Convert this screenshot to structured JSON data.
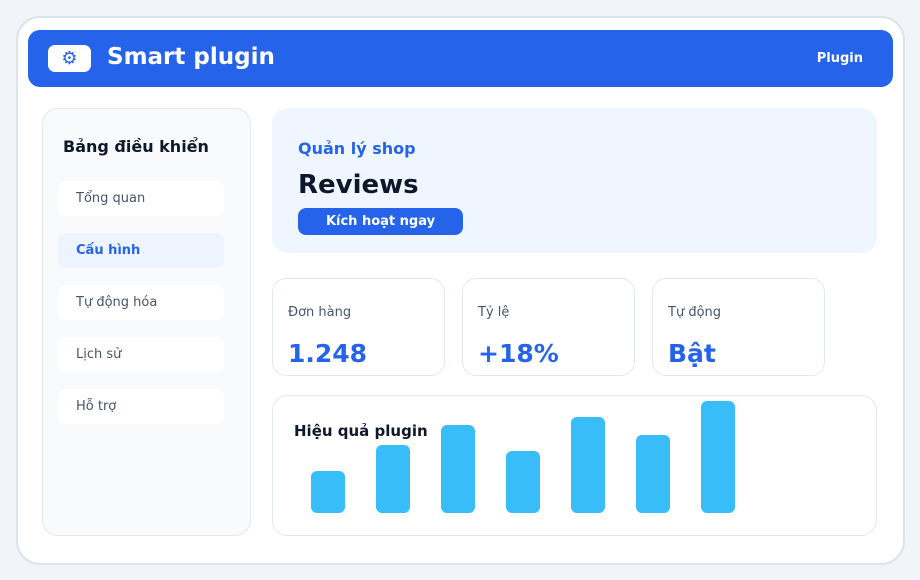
{
  "header": {
    "logo_icon": "gear-icon",
    "title": "Smart plugin",
    "link": "Plugin"
  },
  "sidebar": {
    "title": "Bảng điều khiển",
    "items": [
      {
        "label": "Tổng quan",
        "active": false
      },
      {
        "label": "Cấu hình",
        "active": true
      },
      {
        "label": "Tự động hóa",
        "active": false
      },
      {
        "label": "Lịch sử",
        "active": false
      },
      {
        "label": "Hỗ trợ",
        "active": false
      }
    ]
  },
  "hero": {
    "subtitle": "Quản lý shop",
    "title": "Reviews",
    "button": "Kích hoạt ngay"
  },
  "stats": [
    {
      "label": "Đơn hàng",
      "value": "1.248"
    },
    {
      "label": "Tỷ lệ",
      "value": "+18%"
    },
    {
      "label": "Tự động",
      "value": "Bật"
    }
  ],
  "chart": {
    "title": "Hiệu quả plugin"
  },
  "chart_data": {
    "type": "bar",
    "values": [
      42,
      68,
      88,
      62,
      96,
      78,
      112
    ],
    "ylim": [
      0,
      112
    ],
    "grid": false
  },
  "colors": {
    "accent": "#2563eb",
    "bar": "#38bdf8",
    "hero_bg": "#eff6ff"
  }
}
